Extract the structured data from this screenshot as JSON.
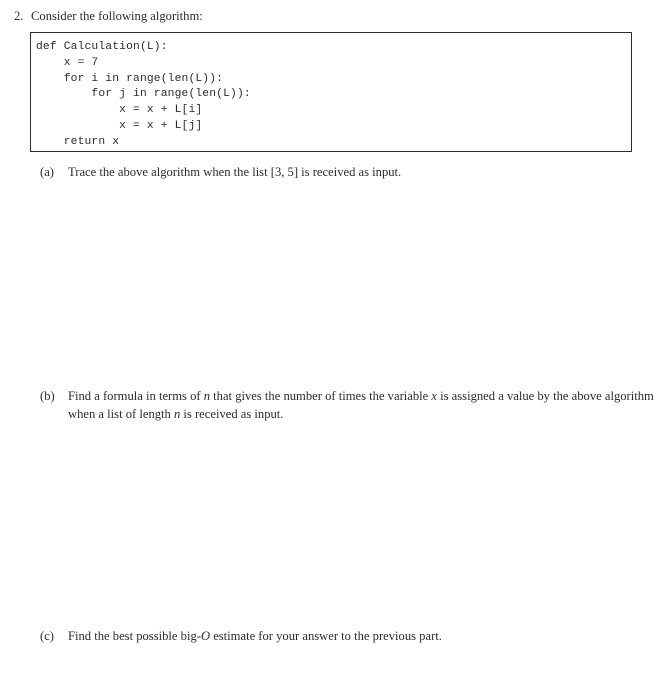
{
  "document": {
    "type": "homework-problem",
    "background_color": "#ffffff",
    "text_color": "#2b2b33"
  },
  "problem": {
    "number": "2.",
    "prompt": "Consider the following algorithm:"
  },
  "code_block": {
    "language": "python",
    "border_color": "#2b2b33",
    "lines": [
      "def Calculation(L):",
      "    x = 7",
      "    for i in range(len(L)):",
      "        for j in range(len(L)):",
      "            x = x + L[i]",
      "            x = x + L[j]",
      "    return x"
    ],
    "text": "def Calculation(L):\n    x = 7\n    for i in range(len(L)):\n        for j in range(len(L)):\n            x = x + L[i]\n            x = x + L[j]\n    return x"
  },
  "subparts": [
    {
      "label": "(a)",
      "text_before": "Trace the above algorithm when the list ",
      "list_value": "[3, 5]",
      "text_after": " is received as input.",
      "full_text": "Trace the above algorithm when the list [3, 5] is received as input."
    },
    {
      "label": "(b)",
      "seg1": "Find a formula in terms of ",
      "var1": "n",
      "seg2": " that gives the number of times the variable ",
      "var2": "x",
      "seg3": " is assigned a value by the above algorithm when a list of length ",
      "var3": "n",
      "seg4": " is received as input.",
      "full_text": "Find a formula in terms of n that gives the number of times the variable x is assigned a value by the above algorithm when a list of length n is received as input."
    },
    {
      "label": "(c)",
      "seg1": "Find the best possible big-",
      "var1": "O",
      "seg2": " estimate for your answer to the previous part.",
      "full_text": "Find the best possible big-O estimate for your answer to the previous part."
    }
  ]
}
